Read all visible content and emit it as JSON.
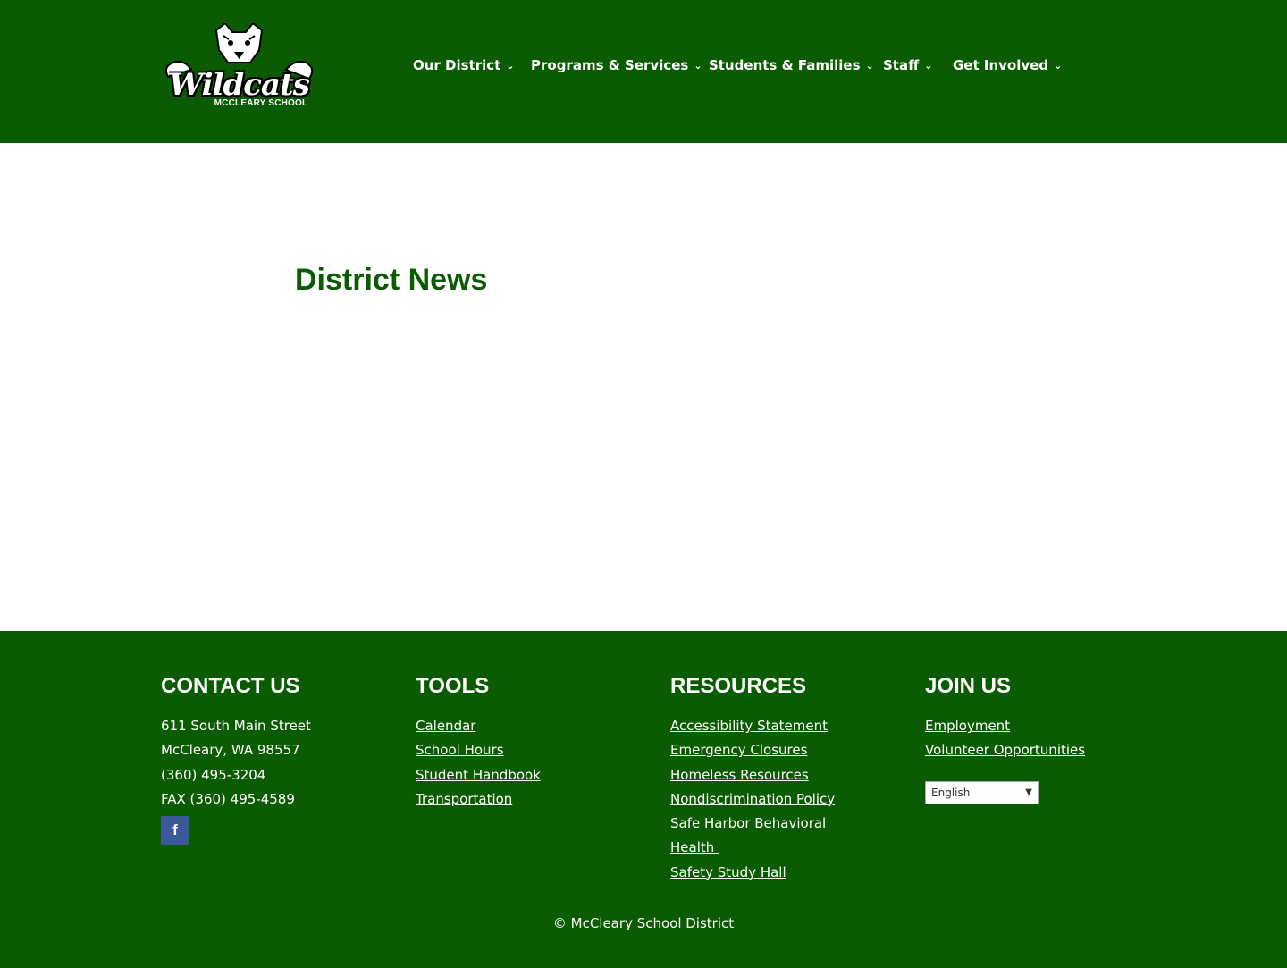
{
  "header": {
    "logo": {
      "word": "Wildcats",
      "subtitle": "MCCLEARY SCHOOL"
    },
    "nav": [
      {
        "label": "Our District"
      },
      {
        "label": "Programs & Services"
      },
      {
        "label": "Students & Families"
      },
      {
        "label": "Staff"
      },
      {
        "label": "Get Involved"
      }
    ]
  },
  "main": {
    "title": "District News"
  },
  "footer": {
    "contact": {
      "heading": "CONTACT US",
      "lines": [
        "611 South Main Street",
        "McCleary, WA 98557",
        "(360) 495-3204",
        "FAX (360) 495-4589"
      ],
      "facebook_label": "f"
    },
    "tools": {
      "heading": "TOOLS",
      "links": [
        "Calendar",
        "School Hours",
        "Student Handbook",
        "Transportation"
      ]
    },
    "resources": {
      "heading": "RESOURCES",
      "links": [
        "Accessibility Statement",
        "Emergency Closures",
        "Homeless Resources",
        "Nondiscrimination Policy",
        "Safe Harbor Behavioral",
        "Health ",
        "Safety Study Hall"
      ]
    },
    "join": {
      "heading": "JOIN US",
      "links": [
        "Employment",
        "Volunteer Opportunities"
      ],
      "language": "English"
    },
    "copyright": "© McCleary School District"
  },
  "colors": {
    "brand_green": "#0b5b02",
    "facebook_blue": "#3b5998"
  }
}
